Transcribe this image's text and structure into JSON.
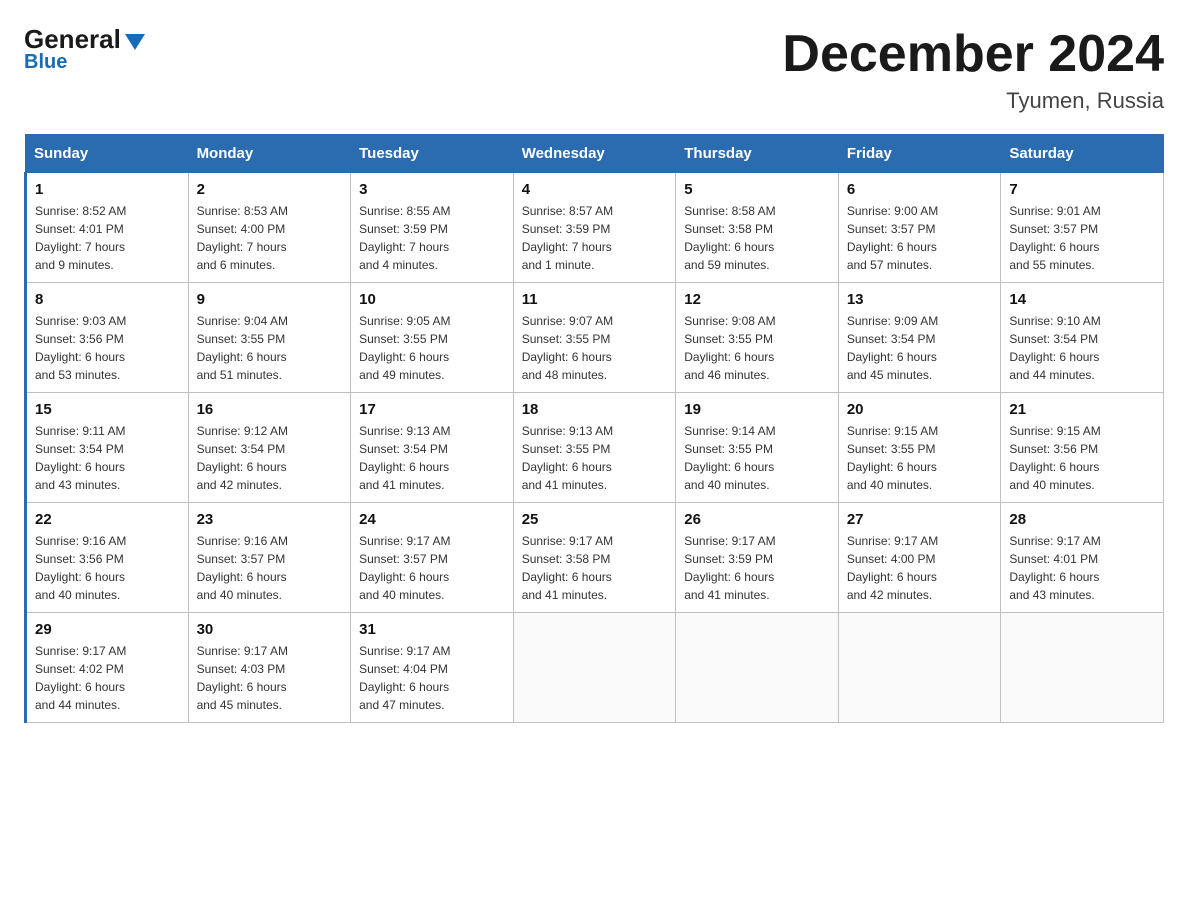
{
  "header": {
    "logo_general": "General",
    "logo_blue": "Blue",
    "title": "December 2024",
    "location": "Tyumen, Russia"
  },
  "weekdays": [
    "Sunday",
    "Monday",
    "Tuesday",
    "Wednesday",
    "Thursday",
    "Friday",
    "Saturday"
  ],
  "weeks": [
    [
      {
        "day": "1",
        "info": "Sunrise: 8:52 AM\nSunset: 4:01 PM\nDaylight: 7 hours\nand 9 minutes."
      },
      {
        "day": "2",
        "info": "Sunrise: 8:53 AM\nSunset: 4:00 PM\nDaylight: 7 hours\nand 6 minutes."
      },
      {
        "day": "3",
        "info": "Sunrise: 8:55 AM\nSunset: 3:59 PM\nDaylight: 7 hours\nand 4 minutes."
      },
      {
        "day": "4",
        "info": "Sunrise: 8:57 AM\nSunset: 3:59 PM\nDaylight: 7 hours\nand 1 minute."
      },
      {
        "day": "5",
        "info": "Sunrise: 8:58 AM\nSunset: 3:58 PM\nDaylight: 6 hours\nand 59 minutes."
      },
      {
        "day": "6",
        "info": "Sunrise: 9:00 AM\nSunset: 3:57 PM\nDaylight: 6 hours\nand 57 minutes."
      },
      {
        "day": "7",
        "info": "Sunrise: 9:01 AM\nSunset: 3:57 PM\nDaylight: 6 hours\nand 55 minutes."
      }
    ],
    [
      {
        "day": "8",
        "info": "Sunrise: 9:03 AM\nSunset: 3:56 PM\nDaylight: 6 hours\nand 53 minutes."
      },
      {
        "day": "9",
        "info": "Sunrise: 9:04 AM\nSunset: 3:55 PM\nDaylight: 6 hours\nand 51 minutes."
      },
      {
        "day": "10",
        "info": "Sunrise: 9:05 AM\nSunset: 3:55 PM\nDaylight: 6 hours\nand 49 minutes."
      },
      {
        "day": "11",
        "info": "Sunrise: 9:07 AM\nSunset: 3:55 PM\nDaylight: 6 hours\nand 48 minutes."
      },
      {
        "day": "12",
        "info": "Sunrise: 9:08 AM\nSunset: 3:55 PM\nDaylight: 6 hours\nand 46 minutes."
      },
      {
        "day": "13",
        "info": "Sunrise: 9:09 AM\nSunset: 3:54 PM\nDaylight: 6 hours\nand 45 minutes."
      },
      {
        "day": "14",
        "info": "Sunrise: 9:10 AM\nSunset: 3:54 PM\nDaylight: 6 hours\nand 44 minutes."
      }
    ],
    [
      {
        "day": "15",
        "info": "Sunrise: 9:11 AM\nSunset: 3:54 PM\nDaylight: 6 hours\nand 43 minutes."
      },
      {
        "day": "16",
        "info": "Sunrise: 9:12 AM\nSunset: 3:54 PM\nDaylight: 6 hours\nand 42 minutes."
      },
      {
        "day": "17",
        "info": "Sunrise: 9:13 AM\nSunset: 3:54 PM\nDaylight: 6 hours\nand 41 minutes."
      },
      {
        "day": "18",
        "info": "Sunrise: 9:13 AM\nSunset: 3:55 PM\nDaylight: 6 hours\nand 41 minutes."
      },
      {
        "day": "19",
        "info": "Sunrise: 9:14 AM\nSunset: 3:55 PM\nDaylight: 6 hours\nand 40 minutes."
      },
      {
        "day": "20",
        "info": "Sunrise: 9:15 AM\nSunset: 3:55 PM\nDaylight: 6 hours\nand 40 minutes."
      },
      {
        "day": "21",
        "info": "Sunrise: 9:15 AM\nSunset: 3:56 PM\nDaylight: 6 hours\nand 40 minutes."
      }
    ],
    [
      {
        "day": "22",
        "info": "Sunrise: 9:16 AM\nSunset: 3:56 PM\nDaylight: 6 hours\nand 40 minutes."
      },
      {
        "day": "23",
        "info": "Sunrise: 9:16 AM\nSunset: 3:57 PM\nDaylight: 6 hours\nand 40 minutes."
      },
      {
        "day": "24",
        "info": "Sunrise: 9:17 AM\nSunset: 3:57 PM\nDaylight: 6 hours\nand 40 minutes."
      },
      {
        "day": "25",
        "info": "Sunrise: 9:17 AM\nSunset: 3:58 PM\nDaylight: 6 hours\nand 41 minutes."
      },
      {
        "day": "26",
        "info": "Sunrise: 9:17 AM\nSunset: 3:59 PM\nDaylight: 6 hours\nand 41 minutes."
      },
      {
        "day": "27",
        "info": "Sunrise: 9:17 AM\nSunset: 4:00 PM\nDaylight: 6 hours\nand 42 minutes."
      },
      {
        "day": "28",
        "info": "Sunrise: 9:17 AM\nSunset: 4:01 PM\nDaylight: 6 hours\nand 43 minutes."
      }
    ],
    [
      {
        "day": "29",
        "info": "Sunrise: 9:17 AM\nSunset: 4:02 PM\nDaylight: 6 hours\nand 44 minutes."
      },
      {
        "day": "30",
        "info": "Sunrise: 9:17 AM\nSunset: 4:03 PM\nDaylight: 6 hours\nand 45 minutes."
      },
      {
        "day": "31",
        "info": "Sunrise: 9:17 AM\nSunset: 4:04 PM\nDaylight: 6 hours\nand 47 minutes."
      },
      {
        "day": "",
        "info": ""
      },
      {
        "day": "",
        "info": ""
      },
      {
        "day": "",
        "info": ""
      },
      {
        "day": "",
        "info": ""
      }
    ]
  ]
}
